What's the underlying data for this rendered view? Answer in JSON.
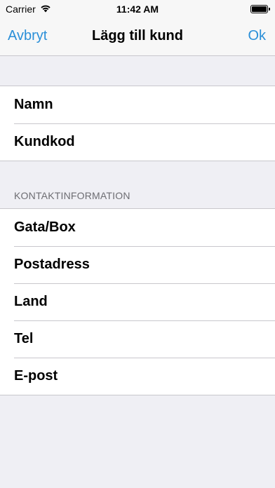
{
  "status_bar": {
    "carrier": "Carrier",
    "time": "11:42 AM"
  },
  "nav": {
    "cancel_label": "Avbryt",
    "title": "Lägg till kund",
    "ok_label": "Ok",
    "accent_color": "#2a8fd8"
  },
  "customer_group": {
    "rows": [
      {
        "label": "Namn"
      },
      {
        "label": "Kundkod"
      }
    ]
  },
  "contact_group": {
    "header": "KONTAKTINFORMATION",
    "rows": [
      {
        "label": "Gata/Box"
      },
      {
        "label": "Postadress"
      },
      {
        "label": "Land"
      },
      {
        "label": "Tel"
      },
      {
        "label": "E-post"
      }
    ]
  }
}
